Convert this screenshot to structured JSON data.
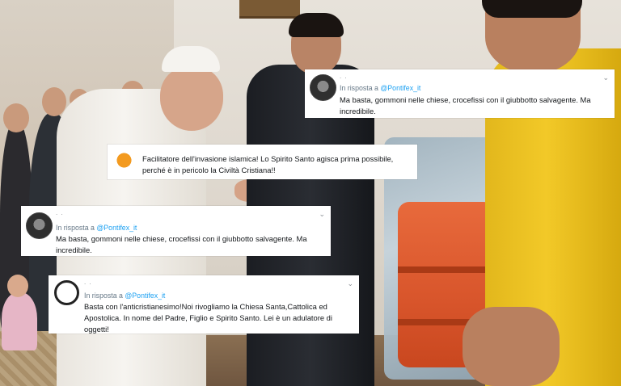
{
  "tweets": [
    {
      "id": "tweet-top-right",
      "avatar_icon": "user-avatar-dark",
      "reply_prefix": "In risposta a",
      "reply_mention": "@Pontifex_it",
      "text": "Ma basta, gommoni nelle chiese, crocefissi con il giubbotto salvagente. Ma incredibile.",
      "menu_icon": "chevron-down-icon"
    },
    {
      "id": "tweet-middle",
      "avatar_icon": "user-avatar-orange",
      "text": "Facilitatore dell'invasione islamica! Lo Spirito Santo agisca prima possibile, perché è in pericolo la Civiltà Cristiana!!"
    },
    {
      "id": "tweet-left",
      "avatar_icon": "user-avatar-dark",
      "reply_prefix": "In risposta a",
      "reply_mention": "@Pontifex_it",
      "text": "Ma basta, gommoni nelle chiese, crocefissi con il giubbotto salvagente. Ma incredibile.",
      "menu_icon": "chevron-down-icon"
    },
    {
      "id": "tweet-bottom",
      "avatar_icon": "user-avatar-ring",
      "reply_prefix": "In risposta a",
      "reply_mention": "@Pontifex_it",
      "text": "Basta con l'anticristianesimo!Noi rivogliamo la Chiesa Santa,Cattolica ed Apostolica. In nome del Padre, Figlio e Spirito Santo. Lei è un adulatore di oggetti!",
      "menu_icon": "chevron-down-icon"
    }
  ],
  "chevron_glyph": "⌄",
  "redacted_handle": ". ."
}
